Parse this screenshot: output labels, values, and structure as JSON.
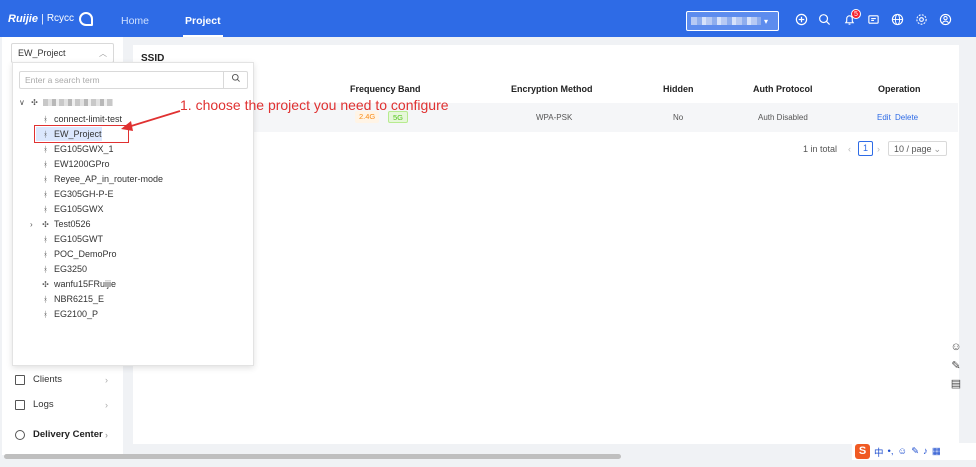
{
  "header": {
    "brand": "Ruijie",
    "brand_sep": "|",
    "brand2": "Rcycc",
    "nav": [
      "Home",
      "Project"
    ],
    "notification_count": "5"
  },
  "sidebar": {
    "project_select": "EW_Project",
    "menu": [
      {
        "label": "Clients"
      },
      {
        "label": "Logs"
      },
      {
        "label": "Delivery Center"
      }
    ]
  },
  "dropdown": {
    "search_placeholder": "Enter a search term",
    "tree": [
      "connect-limit-test",
      "EW_Project",
      "EG105GWX_1",
      "EW1200GPro",
      "Reyee_AP_in_router-mode",
      "EG305GH-P-E",
      "EG105GWX",
      "Test0526",
      "EG105GWT",
      "POC_DemoPro",
      "EG3250",
      "wanfu15FRuijie",
      "NBR6215_E",
      "EG2100_P"
    ]
  },
  "annotation": {
    "text": "1. choose the project you need to configure",
    "color": "#e03131"
  },
  "main": {
    "title": "SSID",
    "columns": [
      "Frequency Band",
      "Encryption Method",
      "Hidden",
      "Auth Protocol",
      "Operation"
    ],
    "row": {
      "bands": [
        "2.4G",
        "5G"
      ],
      "encryption": "WPA-PSK",
      "hidden": "No",
      "auth": "Auth Disabled",
      "edit": "Edit",
      "delete": "Delete"
    },
    "pagination": {
      "total": "1 in total",
      "page": "1",
      "page_size": "10 / page"
    }
  },
  "ime": {
    "label": "中"
  },
  "colors": {
    "primary": "#2e6be6",
    "accent_red": "#e03131"
  }
}
